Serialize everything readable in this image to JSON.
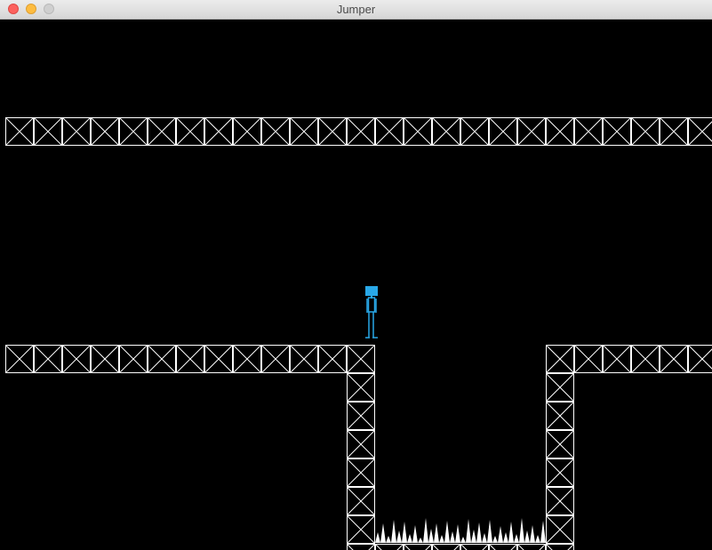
{
  "window": {
    "title": "Jumper"
  },
  "game": {
    "background_color": "#000000",
    "tile_color": "#ffffff",
    "player_color": "#29a8e8",
    "tile_type": "crossed-girder",
    "hazard_type": "white-spikes"
  }
}
